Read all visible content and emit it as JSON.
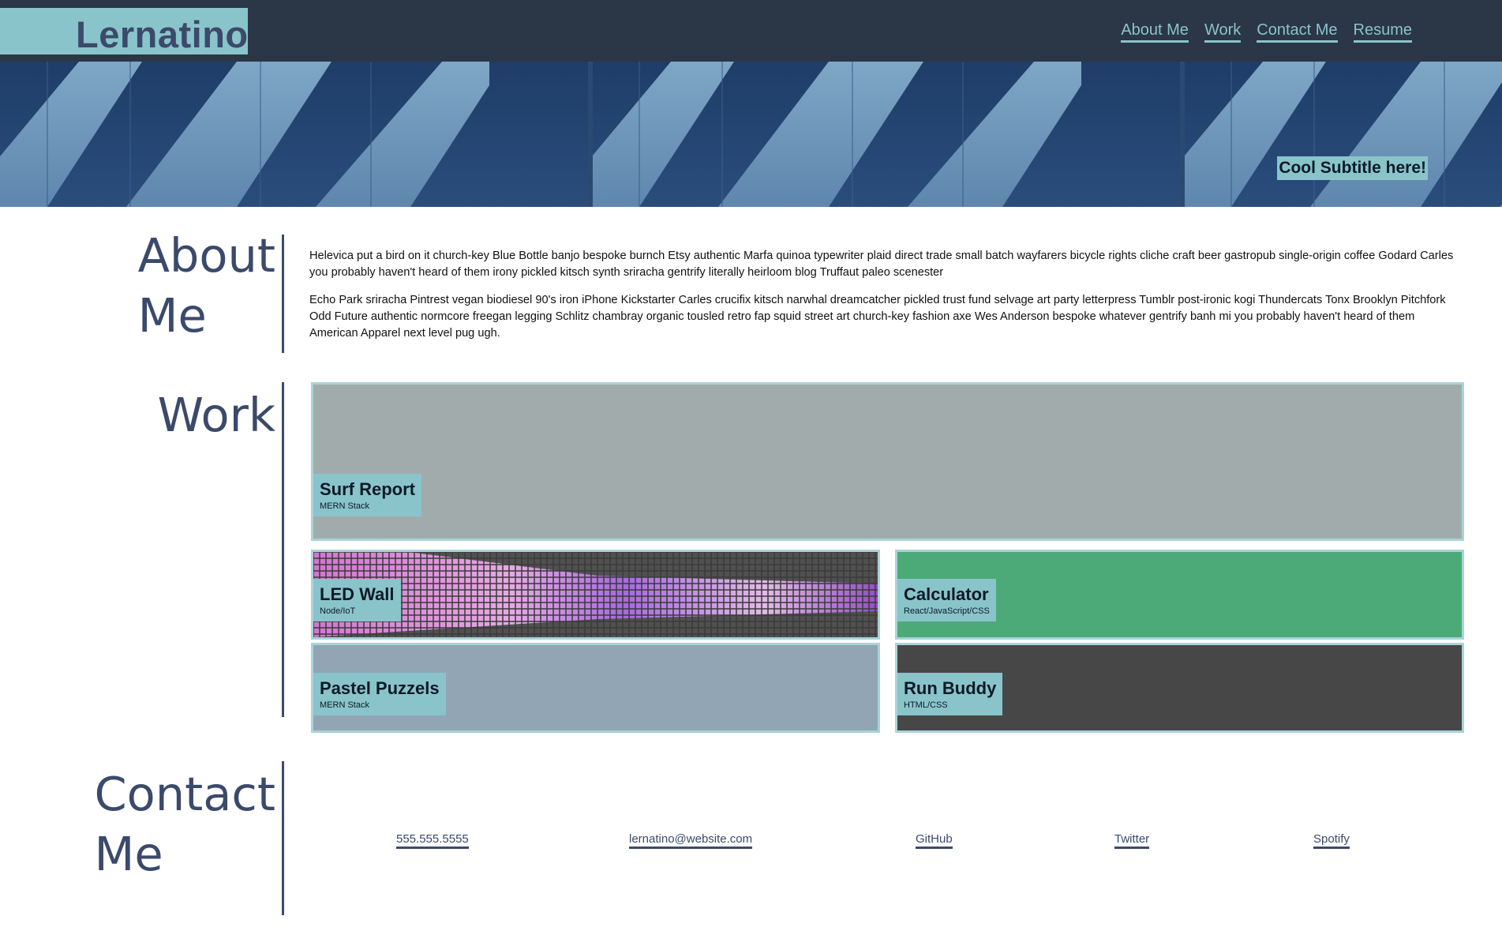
{
  "header": {
    "brand": "Lernatino",
    "nav": [
      "About Me",
      "Work",
      "Contact Me",
      "Resume"
    ]
  },
  "hero": {
    "subtitle": "Cool Subtitle here!"
  },
  "about": {
    "title_line1": "About",
    "title_line2": "Me",
    "paragraphs": [
      "Helevica put a bird on it church-key Blue Bottle banjo bespoke burnch Etsy authentic Marfa quinoa typewriter plaid direct trade small batch wayfarers bicycle rights cliche craft beer gastropub single-origin coffee Godard Carles you probably haven't heard of them irony pickled kitsch synth sriracha gentrify literally heirloom blog Truffaut paleo scenester",
      "Echo Park sriracha Pintrest vegan biodiesel 90's iron iPhone Kickstarter Carles crucifix kitsch narwhal dreamcatcher pickled trust fund selvage art party letterpress Tumblr post-ironic kogi Thundercats Tonx Brooklyn Pitchfork Odd Future authentic normcore freegan legging Schlitz chambray organic tousled retro fap squid street art church-key fashion axe Wes Anderson bespoke whatever gentrify banh mi you probably haven't heard of them American Apparel next level pug ugh."
    ]
  },
  "work": {
    "title": "Work",
    "projects": [
      {
        "name": "Surf Report",
        "stack": "MERN Stack",
        "bg": "#a2abab"
      },
      {
        "name": "LED Wall",
        "stack": "Node/IoT",
        "bg": "#555555"
      },
      {
        "name": "Calculator",
        "stack": "React/JavaScript/CSS",
        "bg": "#4caa78"
      },
      {
        "name": "Pastel Puzzels",
        "stack": "MERN Stack",
        "bg": "#91a5b5"
      },
      {
        "name": "Run Buddy",
        "stack": "HTML/CSS",
        "bg": "#474747"
      }
    ]
  },
  "contact": {
    "title_line1": "Contact",
    "title_line2": "Me",
    "links": [
      "555.555.5555",
      "lernatino@website.com",
      "GitHub",
      "Twitter",
      "Spotify"
    ]
  },
  "colors": {
    "header_bg": "#2b3646",
    "accent": "#89c4cb",
    "heading": "#3b4a6b"
  }
}
